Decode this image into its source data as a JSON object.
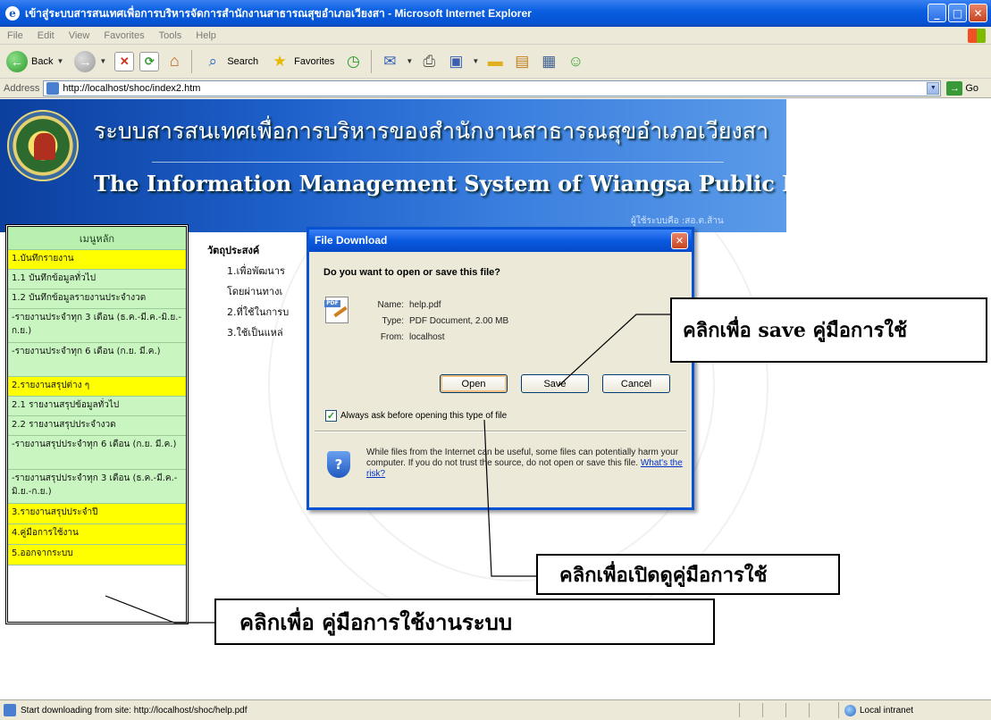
{
  "window": {
    "title": "เข้าสู่ระบบสารสนเทศเพื่อการบริหารจัดการสำนักงานสาธารณสุขอำเภอเวียงสา - Microsoft Internet Explorer",
    "minimize": "_",
    "maximize": "□",
    "close": "✕"
  },
  "menubar": [
    "File",
    "Edit",
    "View",
    "Favorites",
    "Tools",
    "Help"
  ],
  "toolbar": {
    "back_label": "Back",
    "search_label": "Search",
    "favorites_label": "Favorites"
  },
  "address": {
    "label": "Address",
    "url": "http://localhost/shoc/index2.htm",
    "go_label": "Go"
  },
  "banner": {
    "title_th": "ระบบสารสนเทศเพื่อการบริหารของสำนักงานสาธารณสุขอำเภอเวียงสา",
    "title_en": "The Information Management System of Wiangsa Public Health",
    "user": "ผู้ใช้ระบบคือ :สอ.ต.ส้าน"
  },
  "sidebar": {
    "header": "เมนูหลัก",
    "items": [
      {
        "label": "1.บันทึกรายงาน"
      },
      {
        "label": "1.1 บันทึกข้อมูลทั่วไป"
      },
      {
        "label": "1.2 บันทึกข้อมูลรายงานประจำงวด"
      },
      {
        "label": "-รายงานประจำทุก 3 เดือน (ธ.ค.-มี.ค.-มิ.ย.-ก.ย.)"
      },
      {
        "label": "-รายงานประจำทุก 6 เดือน (ก.ย. มี.ค.)"
      },
      {
        "label": "2.รายงานสรุปต่าง ๆ"
      },
      {
        "label": "2.1 รายงานสรุปข้อมูลทั่วไป"
      },
      {
        "label": "2.2 รายงานสรุปประจำงวด"
      },
      {
        "label": "-รายงานสรุปประจำทุก 6 เดือน (ก.ย. มี.ค.)"
      },
      {
        "label": "-รายงานสรุปประจำทุก 3 เดือน (ธ.ค.-มี.ค.-มิ.ย.-ก.ย.)"
      },
      {
        "label": "3.รายงานสรุปประจำปี"
      },
      {
        "label": "4.คู่มือการใช้งาน"
      },
      {
        "label": "5.ออกจากระบบ"
      }
    ]
  },
  "main": {
    "heading": "วัตถุประสงค์",
    "lines": [
      "1.เพื่อพัฒนาร",
      "โดยผ่านทางเ",
      "2.ที่ใช้ในการบ",
      "3.ใช้เป็นแหล่"
    ]
  },
  "dialog": {
    "title": "File Download",
    "question": "Do you want to open or save this file?",
    "name_key": "Name:",
    "name": "help.pdf",
    "type_key": "Type:",
    "type": "PDF Document, 2.00 MB",
    "from_key": "From:",
    "from": "localhost",
    "open_label": "Open",
    "save_label": "Save",
    "cancel_label": "Cancel",
    "checkbox_label": "Always ask before opening this type of file",
    "checkbox_checked": true,
    "warning": "While files from the Internet can be useful, some files can potentially harm your computer. If you do not trust the source, do not open or save this file.",
    "risk_link": "What's the risk?",
    "pdf_icon_tag": "PDF"
  },
  "annotations": {
    "save": "คลิกเพื่อ save คู่มือการใช้",
    "open": "คลิกเพื่อเปิดดูคู่มือการใช้",
    "manual": "คลิกเพื่อ คู่มือการใช้งานระบบ"
  },
  "status": {
    "text": "Start downloading from site: http://localhost/shoc/help.pdf",
    "zone": "Local intranet"
  }
}
